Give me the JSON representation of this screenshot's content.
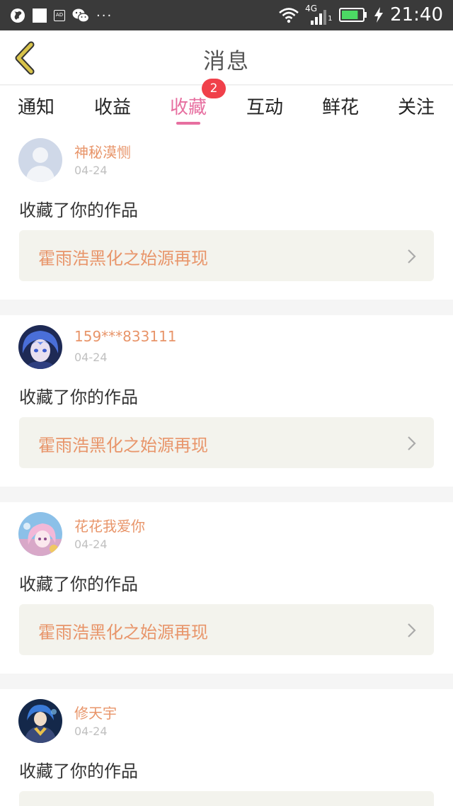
{
  "status_bar": {
    "network": "4G",
    "sim_slot": "1",
    "time": "21:40",
    "battery_percent": 80,
    "more": "···",
    "icons": [
      "globe-icon",
      "notification-square-icon",
      "ad-icon",
      "wechat-icon",
      "wifi-icon",
      "signal-icon",
      "battery-icon",
      "charging-icon"
    ]
  },
  "header": {
    "title": "消息",
    "back_icon": "chevron-left-icon"
  },
  "tabs": [
    {
      "label": "通知"
    },
    {
      "label": "收益"
    },
    {
      "label": "收藏",
      "active": true,
      "badge": "2"
    },
    {
      "label": "互动"
    },
    {
      "label": "鲜花"
    },
    {
      "label": "关注"
    }
  ],
  "messages": [
    {
      "username": "神秘漠恻",
      "date": "04-24",
      "action": "收藏了你的作品",
      "work_title": "霍雨浩黑化之始源再现",
      "avatar": "default-avatar"
    },
    {
      "username": "159***833111",
      "date": "04-24",
      "action": "收藏了你的作品",
      "work_title": "霍雨浩黑化之始源再现",
      "avatar": "anime-avatar-blue-hair"
    },
    {
      "username": "花花我爱你",
      "date": "04-24",
      "action": "收藏了你的作品",
      "work_title": "霍雨浩黑化之始源再现",
      "avatar": "anime-avatar-pink-hair"
    },
    {
      "username": "修天宇",
      "date": "04-24",
      "action": "收藏了你的作品",
      "work_title": "",
      "avatar": "anime-avatar-warrior"
    }
  ],
  "colors": {
    "accent_pink": "#e76fa0",
    "username_orange": "#e8956a",
    "badge_red": "#f0404a",
    "status_bar": "#3a3a3a",
    "back_icon": "#d8c34a",
    "battery_green": "#4cd964"
  }
}
